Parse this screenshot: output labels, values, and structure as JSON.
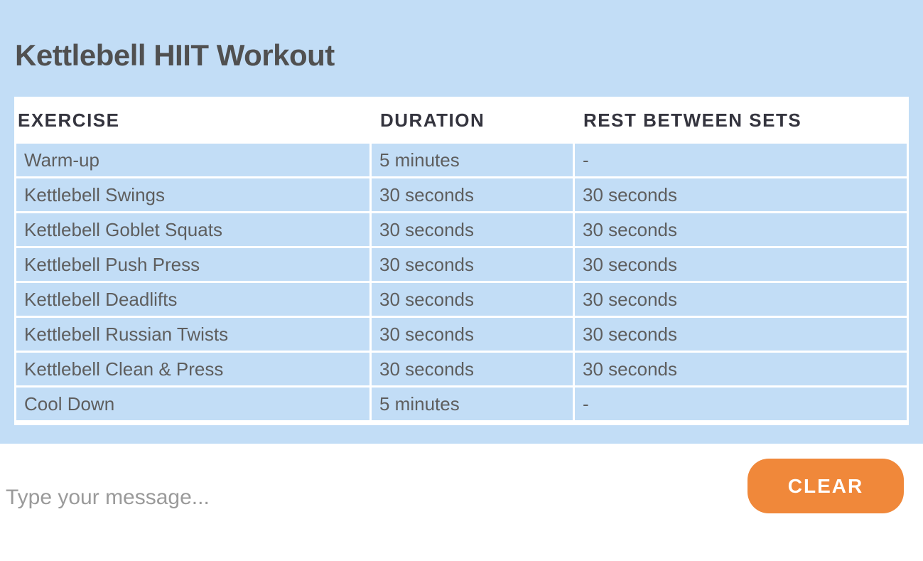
{
  "title": "Kettlebell HIIT Workout",
  "table": {
    "headers": [
      "EXERCISE",
      "DURATION",
      "REST BETWEEN SETS"
    ],
    "rows": [
      [
        "Warm-up",
        "5 minutes",
        "-"
      ],
      [
        "Kettlebell Swings",
        "30 seconds",
        "30 seconds"
      ],
      [
        "Kettlebell Goblet Squats",
        "30 seconds",
        "30 seconds"
      ],
      [
        "Kettlebell Push Press",
        "30 seconds",
        "30 seconds"
      ],
      [
        "Kettlebell Deadlifts",
        "30 seconds",
        "30 seconds"
      ],
      [
        "Kettlebell Russian Twists",
        "30 seconds",
        "30 seconds"
      ],
      [
        "Kettlebell Clean & Press",
        "30 seconds",
        "30 seconds"
      ],
      [
        "Cool Down",
        "5 minutes",
        "-"
      ]
    ]
  },
  "input": {
    "placeholder": "Type your message...",
    "value": ""
  },
  "clear_button": {
    "label": "CLEAR"
  },
  "colors": {
    "panel_bg": "#c2ddf6",
    "accent": "#f0883a"
  }
}
